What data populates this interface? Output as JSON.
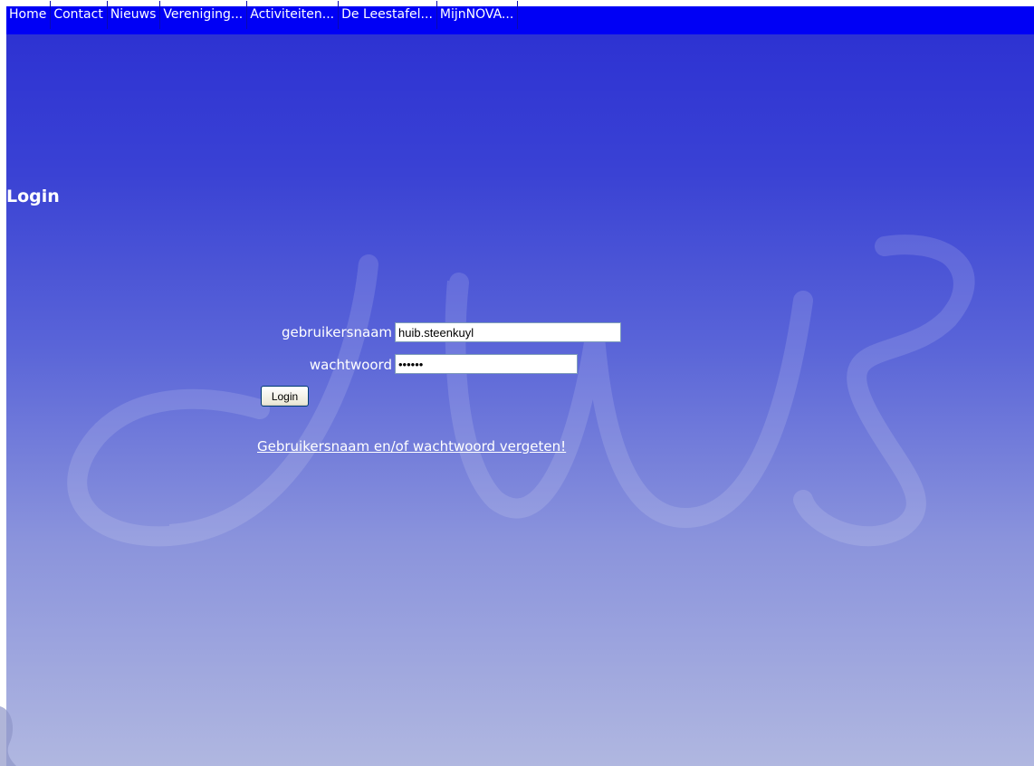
{
  "menu": {
    "items": [
      {
        "label": "Home"
      },
      {
        "label": "Contact"
      },
      {
        "label": "Nieuws"
      },
      {
        "label": "Vereniging..."
      },
      {
        "label": "Activiteiten..."
      },
      {
        "label": "De Leestafel..."
      },
      {
        "label": "MijnNOVA..."
      }
    ]
  },
  "page": {
    "title": "Login"
  },
  "form": {
    "username_label": "gebruikersnaam",
    "username_value": "huib.steenkuyl",
    "password_label": "wachtwoord",
    "password_value": "••••••",
    "submit_label": "Login",
    "forgot_link": "Gebruikersnaam en/of wachtwoord vergeten!"
  },
  "colors": {
    "menubar": "#0000f5",
    "background_top": "#2b2fd2",
    "background_bottom": "#b0b7e0",
    "text": "#ffffff"
  }
}
